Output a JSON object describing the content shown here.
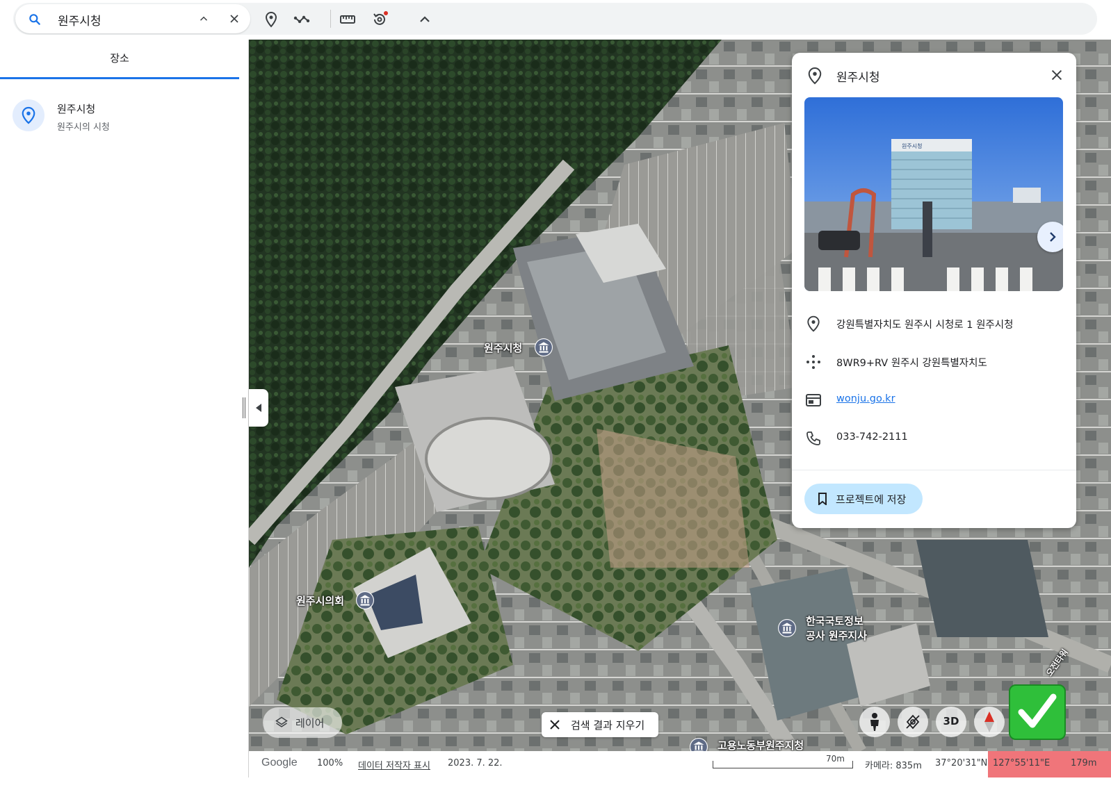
{
  "search": {
    "query": "원주시청"
  },
  "sidebar": {
    "tab_label": "장소",
    "result": {
      "name": "원주시청",
      "description": "원주시의 시청"
    }
  },
  "map": {
    "labels": {
      "city_hall": "원주시청",
      "council": "원주시의회",
      "lx_line1": "한국국토정보",
      "lx_line2": "공사 원주지사",
      "labor_office": "고용노동부원주지청",
      "tower": "오전타워"
    }
  },
  "card": {
    "title": "원주시청",
    "address": "강원특별자치도 원주시 시청로 1 원주시청",
    "plus_code": "8WR9+RV 원주시 강원특별자치도",
    "website": "wonju.go.kr",
    "phone": "033-742-2111",
    "save_label": "프로젝트에 저장",
    "photo_sign": "원주시청"
  },
  "controls": {
    "layers_label": "레이어",
    "clear_results_label": "검색 결과 지우기",
    "threed_label": "3D"
  },
  "status": {
    "brand": "Google",
    "zoom": "100%",
    "data_attribution": "데이터 저작자 표시",
    "date": "2023. 7. 22.",
    "scale": "70m",
    "camera": "카메라: 835m",
    "latitude": "37°20'31\"N",
    "longitude": "127°55'11\"E",
    "elevation": "179m"
  },
  "colors": {
    "accent": "#1a73e8",
    "save_button": "#c2e7ff",
    "status_highlight": "#f0757a",
    "checkmark_badge": "#2fbf3a"
  }
}
